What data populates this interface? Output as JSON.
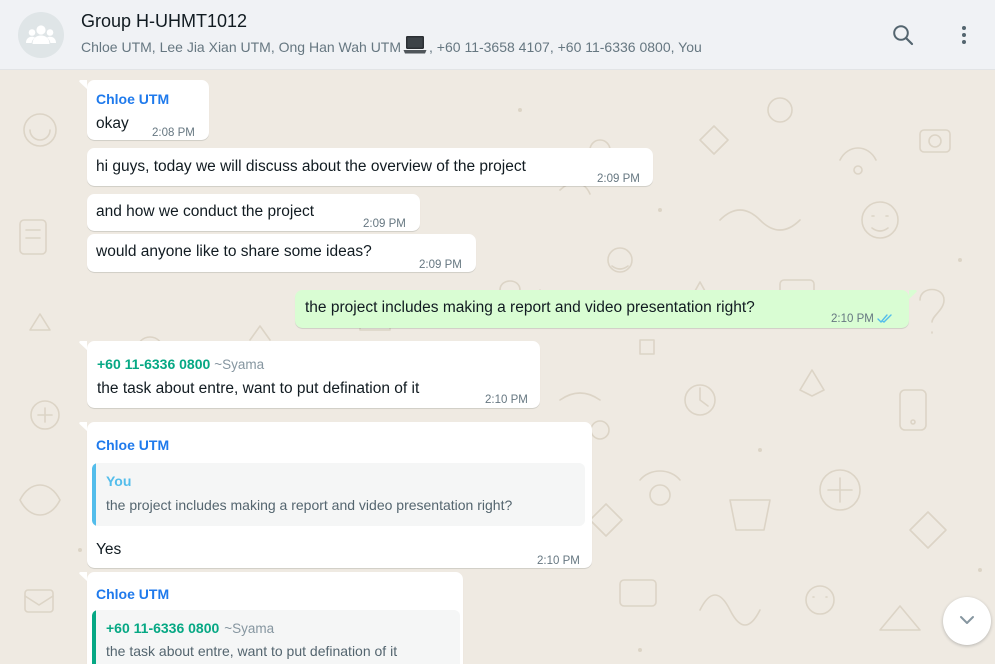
{
  "header": {
    "title": "Group H-UHMT1012",
    "participants_prefix": "Chloe UTM, Lee Jia Xian UTM, Ong Han Wah UTM",
    "participants_suffix": ", +60 11-3658 4107, +60 11-6336 0800, You",
    "icons": [
      "group-avatar-icon",
      "laptop-emoji-icon",
      "search-icon",
      "menu-dots-icon"
    ]
  },
  "messages": [
    {
      "sender": "Chloe UTM",
      "text": "okay",
      "time": "2:08 PM",
      "direction": "in"
    },
    {
      "text": "hi guys, today we will discuss about the overview of the project",
      "time": "2:09 PM",
      "direction": "in"
    },
    {
      "text": "and how we conduct the project",
      "time": "2:09 PM",
      "direction": "in"
    },
    {
      "text": "would anyone like to share some ideas?",
      "time": "2:09 PM",
      "direction": "in"
    },
    {
      "text": "the project includes making a report and video presentation right?",
      "time": "2:10 PM",
      "direction": "out",
      "status": "read"
    },
    {
      "sender": "+60 11-6336 0800",
      "alias": "~Syama",
      "text": "the task about entre, want to put defination of it",
      "time": "2:10 PM",
      "direction": "in"
    },
    {
      "sender": "Chloe UTM",
      "quote": {
        "name": "You",
        "text": "the project includes making a report and video presentation right?"
      },
      "text": "Yes",
      "time": "2:10 PM",
      "direction": "in"
    },
    {
      "sender": "Chloe UTM",
      "quote": {
        "name": "+60 11-6336 0800",
        "alias": "~Syama",
        "text": "the task about entre, want to put defination of it"
      },
      "direction": "in"
    }
  ],
  "colors": {
    "chat_bg": "#efeae2",
    "incoming_bubble": "#ffffff",
    "outgoing_bubble": "#d9fdd3",
    "sender_blue": "#1f7aec",
    "sender_green": "#06a884",
    "read_ticks": "#53bdeb"
  },
  "scroll_down_icon": "chevron-down-icon"
}
